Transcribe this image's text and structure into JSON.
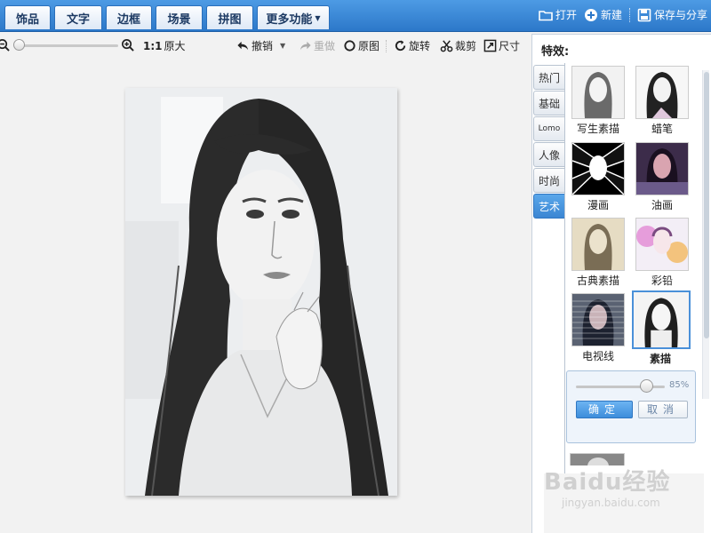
{
  "tabs": [
    "饰品",
    "文字",
    "边框",
    "场景",
    "拼图",
    "更多功能"
  ],
  "top_actions": {
    "open": "打开",
    "new": "新建",
    "save_share": "保存与分享"
  },
  "toolbar": {
    "ratio": "1:1",
    "original_size": "原大",
    "undo": "撤销",
    "redo": "重做",
    "original": "原图",
    "rotate": "旋转",
    "crop": "裁剪",
    "size": "尺寸"
  },
  "panel": {
    "title": "特效:",
    "tabs": [
      {
        "label": "热门",
        "active": false
      },
      {
        "label": "基础",
        "active": false
      },
      {
        "label": "Lomo",
        "active": false
      },
      {
        "label": "人像",
        "active": false
      },
      {
        "label": "时尚",
        "active": false
      },
      {
        "label": "艺术",
        "active": true
      }
    ],
    "effects": [
      {
        "label": "写生素描"
      },
      {
        "label": "蜡笔"
      },
      {
        "label": "漫画"
      },
      {
        "label": "油画"
      },
      {
        "label": "古典素描"
      },
      {
        "label": "彩铅"
      },
      {
        "label": "电视线"
      },
      {
        "label": "素描",
        "selected": true
      }
    ],
    "intensity": "85%",
    "intensity_value": 0.85,
    "confirm": "确定",
    "cancel": "取消"
  },
  "watermark": {
    "main": "Baidu经验",
    "sub": "jingyan.baidu.com"
  },
  "colors": {
    "topbar": "#3a87d6",
    "accent": "#4a90d9"
  }
}
